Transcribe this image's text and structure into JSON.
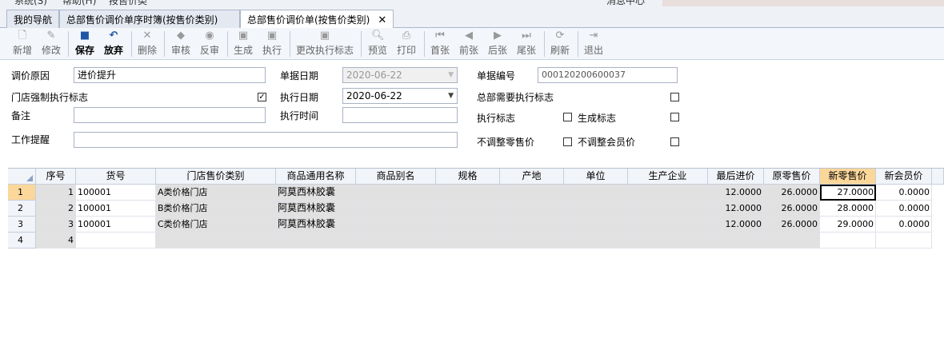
{
  "top_strip": {
    "text1": "系统(S)",
    "text2": "帮助(H)",
    "text3": "按售价类",
    "text4": "消息中心"
  },
  "tabs": [
    {
      "label": "我的导航"
    },
    {
      "label": "总部售价调价单序时簿(按售价类别)"
    },
    {
      "label": "总部售价调价单(按售价类别)",
      "close": "✕"
    }
  ],
  "toolbar": {
    "new": "新增",
    "edit": "修改",
    "save": "保存",
    "discard": "放弃",
    "delete": "删除",
    "audit": "审核",
    "unaudit": "反审",
    "generate": "生成",
    "execute": "执行",
    "change_flag": "更改执行标志",
    "preview": "预览",
    "print": "打印",
    "first": "首张",
    "prev": "前张",
    "next": "后张",
    "last": "尾张",
    "refresh": "刷新",
    "exit": "退出"
  },
  "form": {
    "reason_label": "调价原因",
    "reason_value": "进价提升",
    "doc_date_label": "单据日期",
    "doc_date_value": "2020-06-22",
    "doc_no_label": "单据编号",
    "doc_no_value": "000120200600037",
    "store_force_label": "门店强制执行标志",
    "store_force_checked": "✓",
    "exec_date_label": "执行日期",
    "exec_date_value": "2020-06-22",
    "hq_need_exec_label": "总部需要执行标志",
    "remark_label": "备注",
    "remark_value": "",
    "exec_time_label": "执行时间",
    "exec_time_value": "",
    "exec_flag_label": "执行标志",
    "gen_flag_label": "生成标志",
    "reminder_label": "工作提醒",
    "reminder_value": "",
    "no_adjust_retail_label": "不调整零售价",
    "no_adjust_member_label": "不调整会员价"
  },
  "grid": {
    "columns": [
      "序号",
      "货号",
      "门店售价类别",
      "商品通用名称",
      "商品别名",
      "规格",
      "产地",
      "单位",
      "生产企业",
      "最后进价",
      "原零售价",
      "新零售价",
      "新会员价"
    ],
    "rows": [
      {
        "rownum": "1",
        "seq": "1",
        "code": "100001",
        "price_class": "A类价格门店",
        "name": "阿莫西林胶囊",
        "last_cost": "12.0000",
        "old_retail": "26.0000",
        "new_retail": "27.0000",
        "new_member": "0.0000"
      },
      {
        "rownum": "2",
        "seq": "2",
        "code": "100001",
        "price_class": "B类价格门店",
        "name": "阿莫西林胶囊",
        "last_cost": "12.0000",
        "old_retail": "26.0000",
        "new_retail": "28.0000",
        "new_member": "0.0000"
      },
      {
        "rownum": "3",
        "seq": "3",
        "code": "100001",
        "price_class": "C类价格门店",
        "name": "阿莫西林胶囊",
        "last_cost": "12.0000",
        "old_retail": "26.0000",
        "new_retail": "29.0000",
        "new_member": "0.0000"
      },
      {
        "rownum": "4",
        "seq": "4",
        "code": "",
        "price_class": "",
        "name": "",
        "last_cost": "",
        "old_retail": "",
        "new_retail": "",
        "new_member": ""
      }
    ]
  }
}
